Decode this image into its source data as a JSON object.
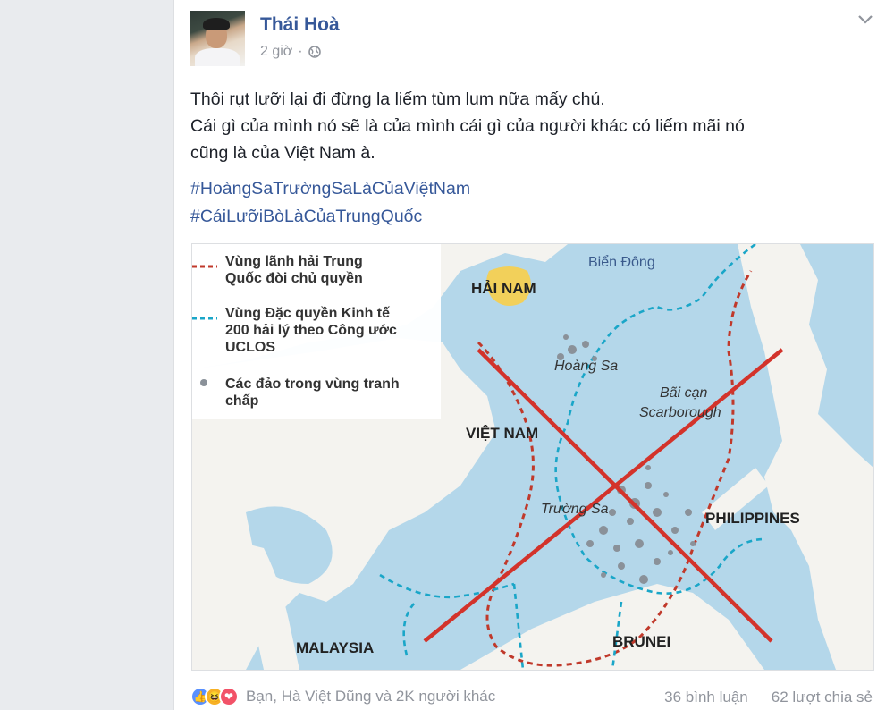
{
  "post": {
    "author": "Thái Hoà",
    "time": "2 giờ",
    "separator": "·",
    "text_lines": [
      "Thôi rụt lưỡi lại đi đừng la liếm tùm lum nữa mấy chú.",
      "Cái gì của mình nó sẽ là của mình cái gì của người khác có liếm mãi nó",
      "cũng là của Việt Nam à."
    ],
    "hashtags": [
      "#HoàngSaTrườngSaLàCủaViệtNam",
      "#CáiLưỡiBòLàCủaTrungQuốc"
    ]
  },
  "map": {
    "legend": {
      "red_line": "Vùng lãnh hải Trung Quốc đòi chủ quyền",
      "red_line_1": "Vùng lãnh hải Trung",
      "red_line_2": "Quốc đòi chủ quyền",
      "blue_line_1": "Vùng Đặc quyền Kinh tế",
      "blue_line_2": "200 hải lý theo Công ước",
      "blue_line_3": "UCLOS",
      "dots_1": "Các đảo trong vùng tranh",
      "dots_2": "chấp"
    },
    "labels": {
      "sea": "Biển Đông",
      "hainam": "HẢI NAM",
      "hoangsa": "Hoàng Sa",
      "scarborough_1": "Bãi cạn",
      "scarborough_2": "Scarborough",
      "vietnam": "VIỆT NAM",
      "truongsa": "Trường Sa",
      "philippines": "PHILIPPINES",
      "malaysia": "MALAYSIA",
      "brunei": "BRUNEI"
    },
    "colors": {
      "sea": "#b4d7ea",
      "land": "#f4f3ef",
      "red_dashed": "#c0392b",
      "blue_dashed": "#1aa6c8",
      "cross": "#d3332b",
      "hainan": "#f2d05a"
    }
  },
  "footer": {
    "reactions_text": "Bạn, Hà Việt Dũng và 2K người khác",
    "comments": "36 bình luận",
    "shares": "62 lượt chia sẻ",
    "reaction_icons": [
      "like-icon",
      "haha-icon",
      "love-icon"
    ]
  },
  "colors": {
    "link": "#365899",
    "muted": "#90949c",
    "text": "#1d2129",
    "page_bg": "#e9ebee"
  }
}
